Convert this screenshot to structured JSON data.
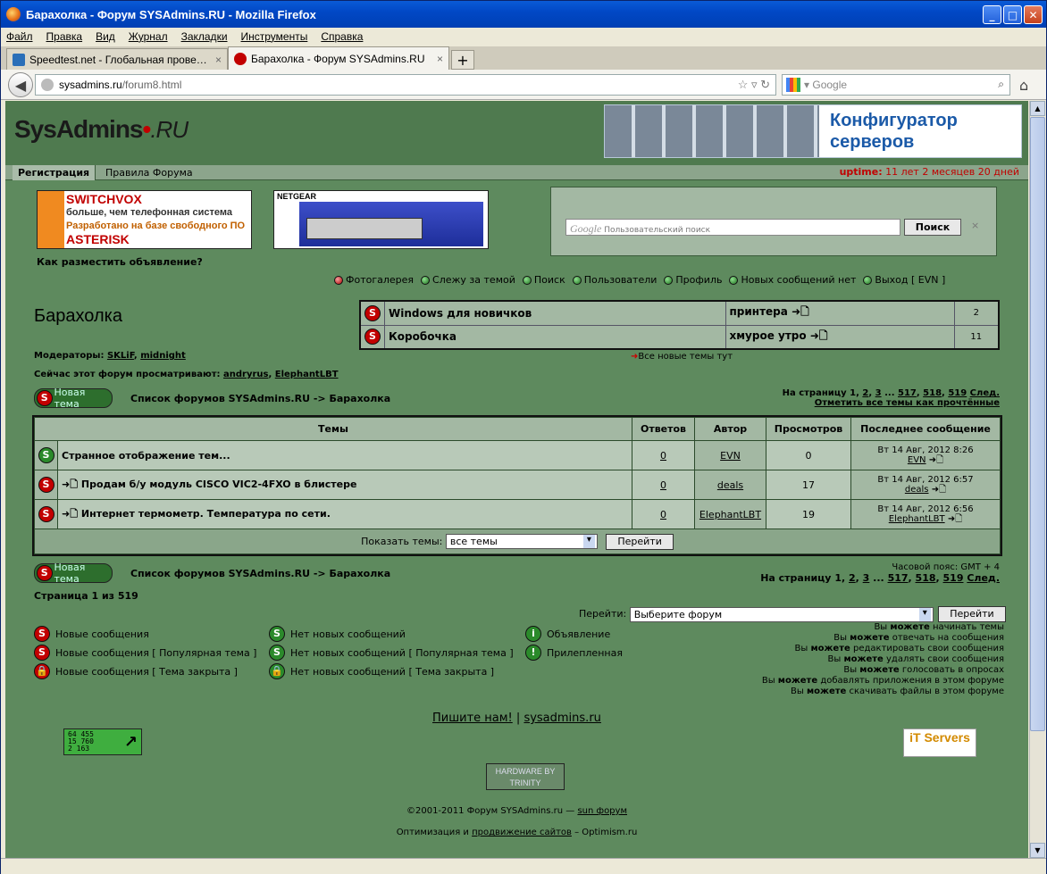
{
  "browser": {
    "title": "Барахолка - Форум SYSAdmins.RU - Mozilla Firefox",
    "menu": [
      "Файл",
      "Правка",
      "Вид",
      "Журнал",
      "Закладки",
      "Инструменты",
      "Справка"
    ],
    "tabs": [
      {
        "label": "Speedtest.net - Глобальная проверка с...",
        "close": "×"
      },
      {
        "label": "Барахолка - Форум SYSAdmins.RU",
        "close": "×"
      }
    ],
    "newtab": "+",
    "url_host": "sysadmins.ru",
    "url_path": "/forum8.html",
    "search_placeholder": "Google",
    "icons": {
      "back": "back-arrow-icon",
      "star": "bookmark-star-icon",
      "reload": "reload-icon",
      "search": "magnifier-icon",
      "home": "home-icon"
    }
  },
  "site": {
    "logo_sys": "Sys",
    "logo_admins": "Admins",
    "logo_ru": ".RU",
    "banner": "Конфигуратор серверов",
    "nav_register": "Регистрация",
    "nav_rules": "Правила Форума",
    "uptime_label": "uptime:",
    "uptime_value": "11 лет 2 месяцев 20 дней",
    "ad1_title1": "SWITCHVOX",
    "ad1_line1": "больше, чем телефонная система",
    "ad1_line2": "Разработано на базе свободного ПО",
    "ad1_title2": "ASTERISK",
    "ad2_brand": "NETGEAR",
    "howto": "Как разместить объявление?",
    "cse_prefix": "Google",
    "cse_placeholder": "Пользовательский поиск",
    "cse_button": "Поиск",
    "cse_clear": "×",
    "menu": [
      "Фотогалерея",
      "Слежу за темой",
      "Поиск",
      "Пользователи",
      "Профиль",
      "Новых сообщений нет",
      "Выход [ EVN ]"
    ]
  },
  "forum": {
    "title": "Барахолка",
    "top_topics": [
      {
        "title": "Windows для новичков",
        "last": "принтера",
        "count": "2"
      },
      {
        "title": "Коробочка",
        "last": "хмурое утро",
        "count": "11"
      }
    ],
    "all_new": "Все новые темы тут",
    "moderators_label": "Модераторы:",
    "moderators": [
      "SKLiF",
      "midnight"
    ],
    "viewers_label": "Сейчас этот форум просматривают:",
    "viewers": [
      "andryrus",
      "ElephantLBT"
    ],
    "new_topic": "Новая тема",
    "crumb_root": "Список форумов SYSAdmins.RU",
    "crumb_sep": "->",
    "crumb_leaf": "Барахолка",
    "pages_label": "На страницу",
    "pages": [
      "1",
      "2",
      "3",
      "...",
      "517",
      "518",
      "519"
    ],
    "next": "След.",
    "mark_read": "Отметить все темы как прочтённые",
    "table": {
      "headers": [
        "Темы",
        "Ответов",
        "Автор",
        "Просмотров",
        "Последнее сообщение"
      ],
      "rows": [
        {
          "icon": "new",
          "title": "Странное отображение тем...",
          "replies": "0",
          "author": "EVN",
          "views": "0",
          "date": "Вт 14 Авг, 2012 8:26",
          "by": "EVN"
        },
        {
          "icon": "hot",
          "title": "Продам б/у модуль CISCO VIC2-4FXO в блистере",
          "replies": "0",
          "author": "deals",
          "views": "17",
          "date": "Вт 14 Авг, 2012 6:57",
          "by": "deals"
        },
        {
          "icon": "hot",
          "title": "Интернет термометр. Температура по сети.",
          "replies": "0",
          "author": "ElephantLBT",
          "views": "19",
          "date": "Вт 14 Авг, 2012 6:56",
          "by": "ElephantLBT"
        }
      ],
      "show_label": "Показать темы:",
      "show_value": "все темы",
      "go": "Перейти"
    },
    "timezone": "Часовой пояс: GMT + 4",
    "page_of": "Страница 1 из 519",
    "jump_label": "Перейти:",
    "jump_value": "Выберите форум",
    "jump_go": "Перейти",
    "legend": [
      "Новые сообщения",
      "Новые сообщения [ Популярная тема ]",
      "Новые сообщения [ Тема закрыта ]",
      "Нет новых сообщений",
      "Нет новых сообщений [ Популярная тема ]",
      "Нет новых сообщений [ Тема закрыта ]",
      "Объявление",
      "Прилепленная"
    ],
    "perms": [
      [
        "Вы",
        "можете",
        "начинать темы"
      ],
      [
        "Вы",
        "можете",
        "отвечать на сообщения"
      ],
      [
        "Вы",
        "можете",
        "редактировать свои сообщения"
      ],
      [
        "Вы",
        "можете",
        "удалять свои сообщения"
      ],
      [
        "Вы",
        "можете",
        "голосовать в опросах"
      ],
      [
        "Вы",
        "можете",
        "добавлять приложения в этом форуме"
      ],
      [
        "Вы",
        "можете",
        "скачивать файлы в этом форуме"
      ]
    ],
    "write_us": "Пишите нам!",
    "footer_sep": "|",
    "site_link": "sysadmins.ru",
    "counter": [
      "64 455",
      "15 760",
      "2 163"
    ],
    "its": "iT Servers",
    "hw": "HARDWARE BY TRINITY",
    "copyright": "©2001-2011 Форум SYSAdmins.ru —",
    "copyright_link": "sun форум",
    "optim_pre": "Оптимизация и",
    "optim_link": "продвижение сайтов",
    "optim_post": "– Optimism.ru"
  }
}
